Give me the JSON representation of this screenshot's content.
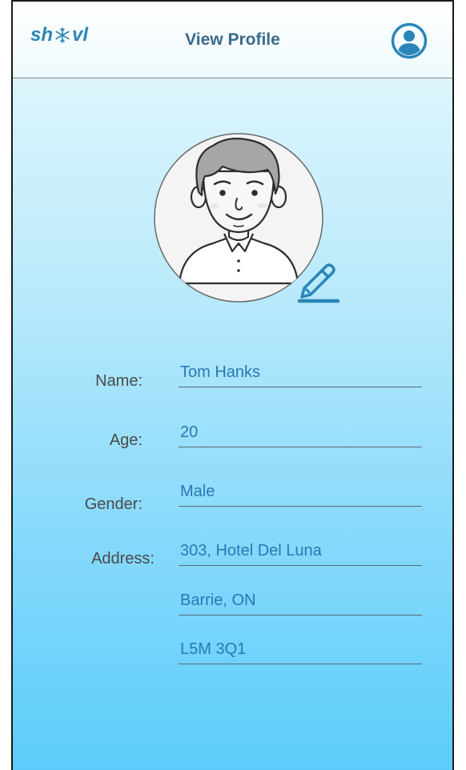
{
  "header": {
    "logo_left": "sh",
    "logo_right": "vl",
    "title": "View Profile",
    "profile_icon": "user-circle-icon"
  },
  "avatar": {
    "icon": "user-avatar-illustration",
    "edit_icon": "pencil-edit-icon"
  },
  "form": {
    "name_label": "Name:",
    "name_value": "Tom Hanks",
    "age_label": "Age:",
    "age_value": "20",
    "gender_label": "Gender:",
    "gender_value": "Male",
    "address_label": "Address:",
    "address_line1": "303, Hotel Del Luna",
    "address_line2": "Barrie, ON",
    "address_line3": "L5M 3Q1"
  },
  "colors": {
    "accent": "#2a86b8",
    "value_text": "#2a78b4",
    "label_text": "#4a4a4a"
  }
}
